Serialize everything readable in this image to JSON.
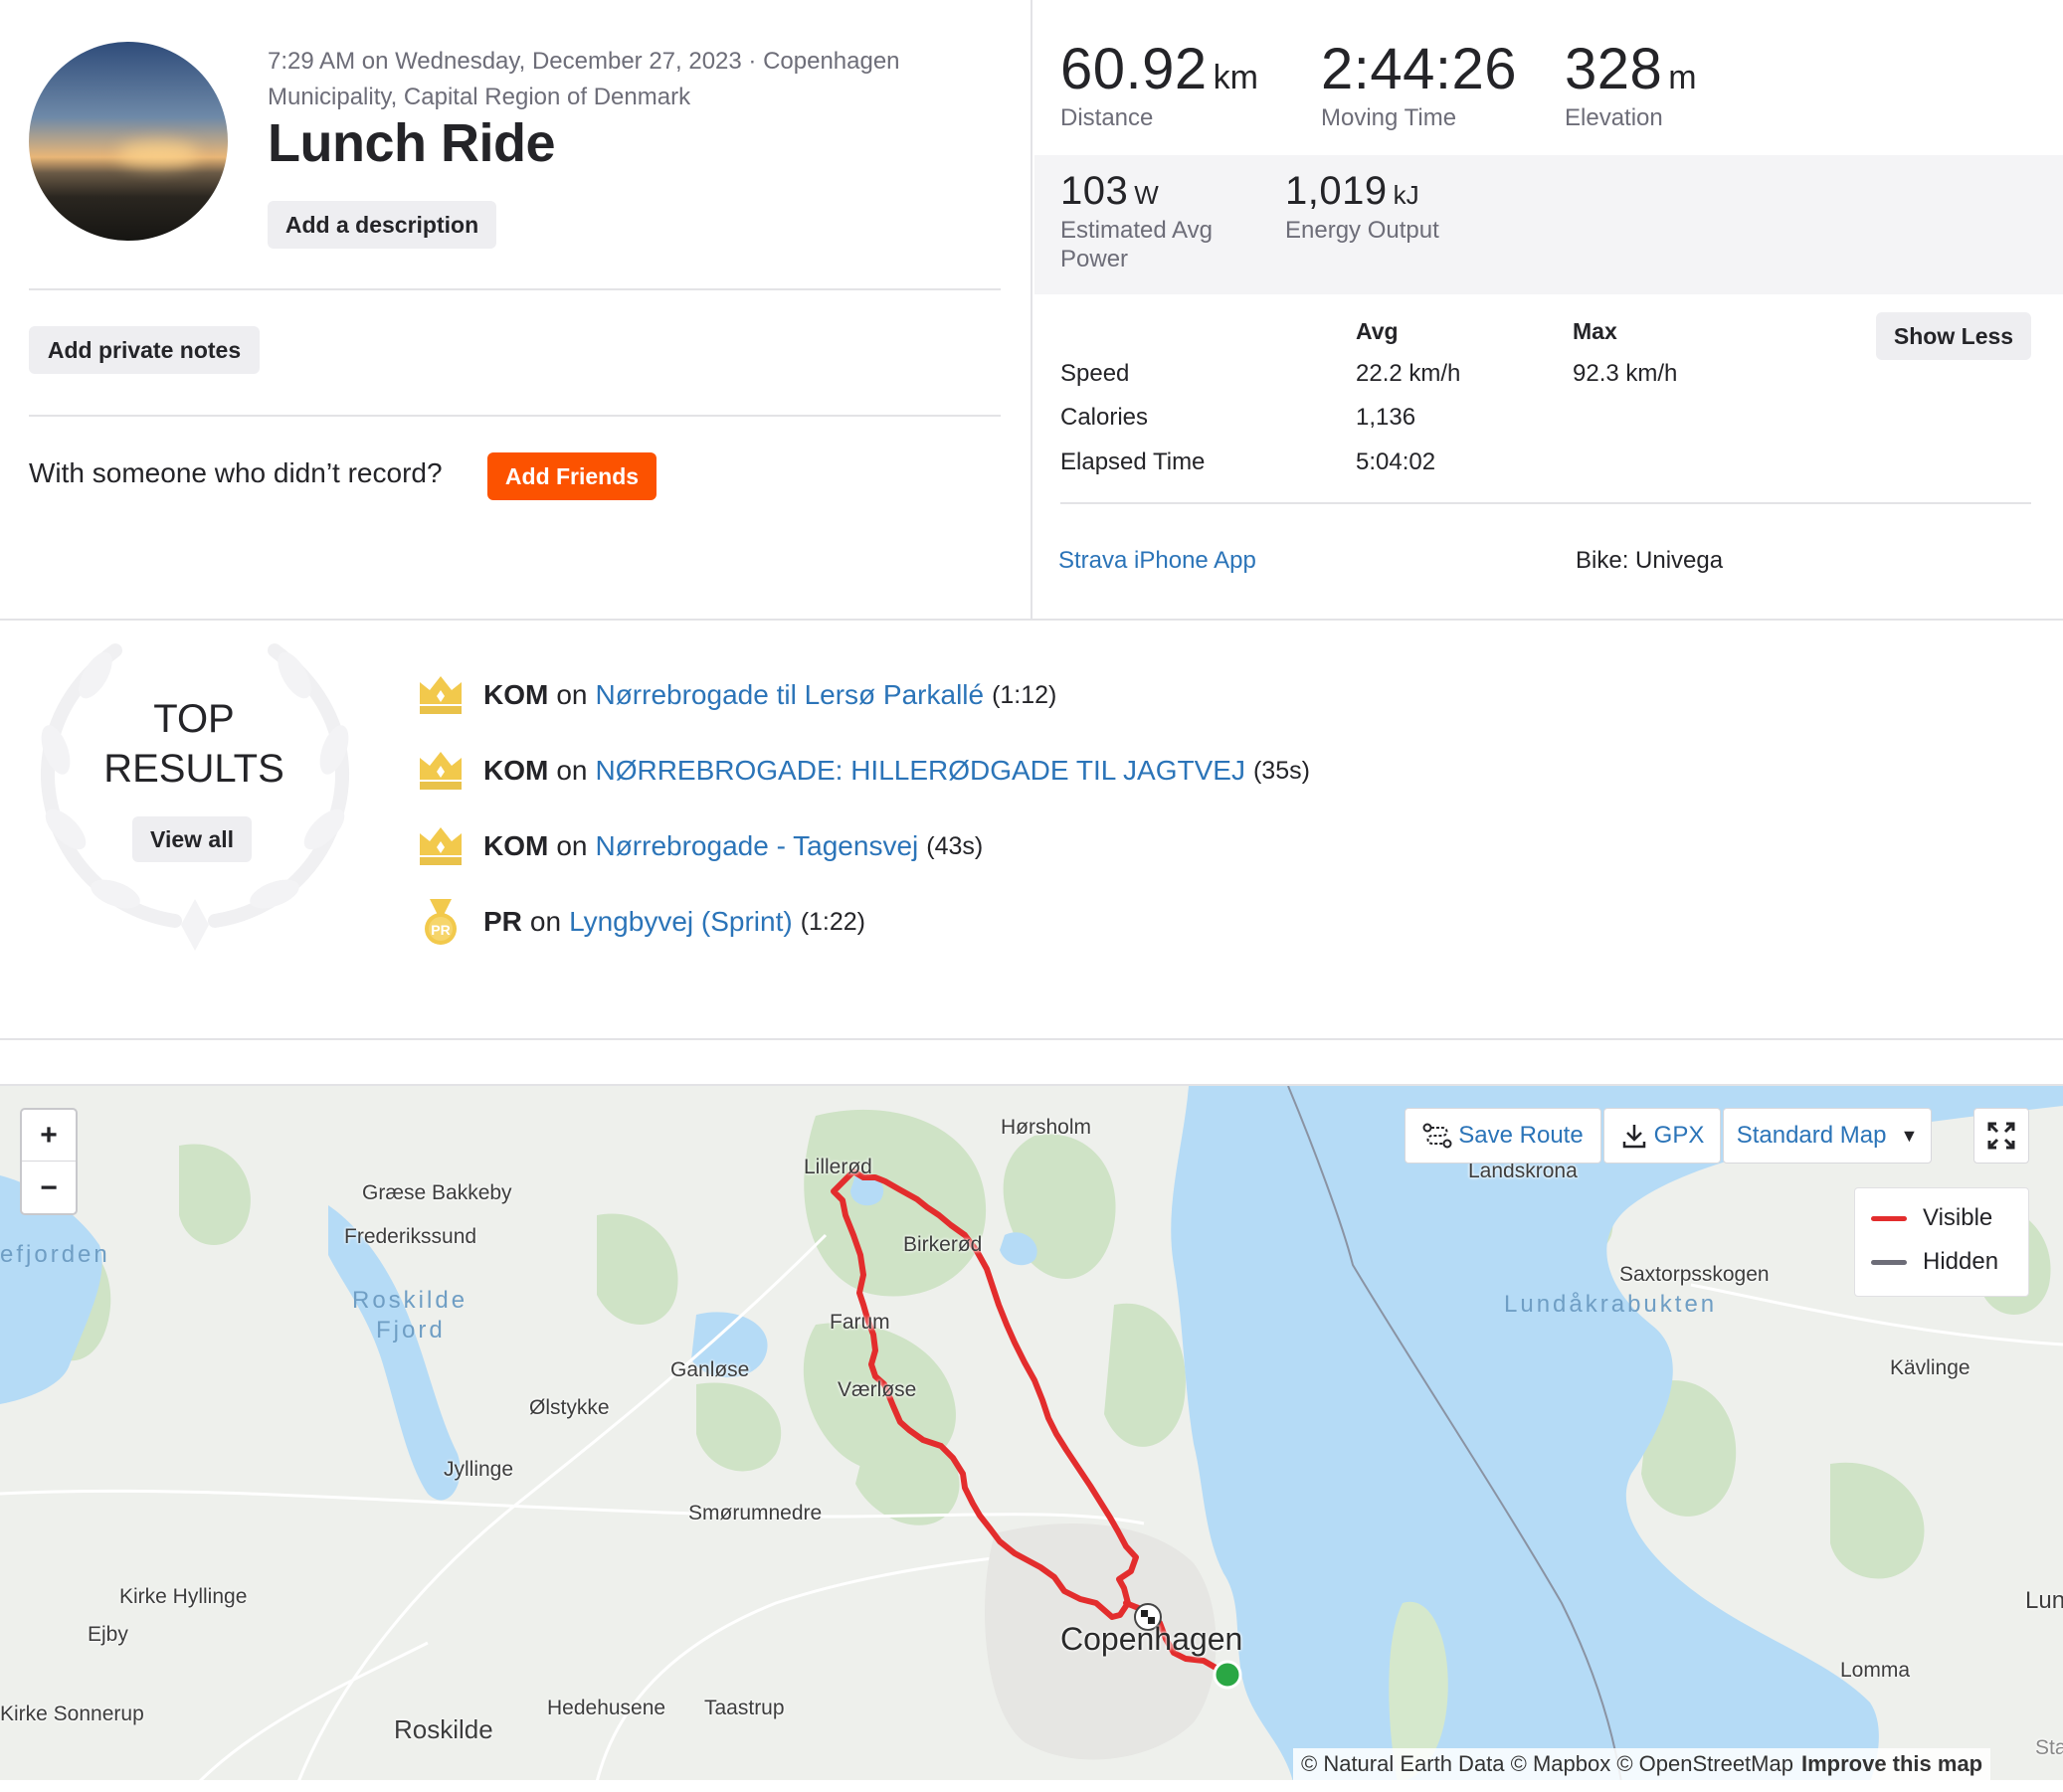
{
  "activity": {
    "datetime_location": "7:29 AM on Wednesday, December 27, 2023 · Copenhagen Municipality, Capital Region of Denmark",
    "title": "Lunch Ride",
    "add_description_label": "Add a description",
    "add_private_notes_label": "Add private notes",
    "friends_prompt": "With someone who didn’t record?",
    "add_friends_label": "Add Friends"
  },
  "stats": {
    "primary": [
      {
        "value": "60.92",
        "unit": "km",
        "label": "Distance"
      },
      {
        "value": "2:44:26",
        "unit": "",
        "label": "Moving Time"
      },
      {
        "value": "328",
        "unit": "m",
        "label": "Elevation"
      }
    ],
    "secondary": [
      {
        "value": "103",
        "unit": "W",
        "label": "Estimated Avg Power"
      },
      {
        "value": "1,019",
        "unit": "kJ",
        "label": "Energy Output"
      }
    ],
    "table": {
      "col_avg": "Avg",
      "col_max": "Max",
      "rows": [
        {
          "label": "Speed",
          "avg": "22.2 km/h",
          "max": "92.3 km/h"
        },
        {
          "label": "Calories",
          "avg": "1,136",
          "max": ""
        },
        {
          "label": "Elapsed Time",
          "avg": "5:04:02",
          "max": ""
        }
      ]
    },
    "show_less_label": "Show Less",
    "device": "Strava iPhone App",
    "bike": "Bike: Univega"
  },
  "top_results": {
    "title_line1": "TOP",
    "title_line2": "RESULTS",
    "view_all_label": "View all",
    "on_label": "on",
    "items": [
      {
        "type": "KOM",
        "icon": "crown-icon",
        "segment": "Nørrebrogade til Lersø Parkallé",
        "time": "(1:12)"
      },
      {
        "type": "KOM",
        "icon": "crown-icon",
        "segment": "NØRREBROGADE: HILLERØDGADE TIL JAGTVEJ",
        "time": "(35s)"
      },
      {
        "type": "KOM",
        "icon": "crown-icon",
        "segment": "Nørrebrogade - Tagensvej",
        "time": "(43s)"
      },
      {
        "type": "PR",
        "icon": "pr-medal-icon",
        "segment": "Lyngbyvej (Sprint)",
        "time": "(1:22)"
      }
    ]
  },
  "map": {
    "zoom_in": "+",
    "zoom_out": "−",
    "save_route_label": "Save Route",
    "gpx_label": "GPX",
    "map_style_label": "Standard Map",
    "legend": {
      "visible": "Visible",
      "hidden": "Hidden",
      "visible_color": "#e32d2d",
      "hidden_color": "#6d6d78"
    },
    "attribution": "© Natural Earth Data © Mapbox © OpenStreetMap",
    "improve_label": "Improve this map",
    "partial_labels": {
      "staf": "Staf",
      "landskrona": "Landskrona"
    },
    "places": [
      {
        "key": "horsholm",
        "name": "Hørsholm"
      },
      {
        "key": "lillerod",
        "name": "Lillerød"
      },
      {
        "key": "graese",
        "name": "Græse Bakkeby"
      },
      {
        "key": "frederikssund",
        "name": "Frederikssund"
      },
      {
        "key": "birkerod",
        "name": "Birkerød"
      },
      {
        "key": "farum",
        "name": "Farum"
      },
      {
        "key": "ganlose",
        "name": "Ganløse"
      },
      {
        "key": "vaerlose",
        "name": "Værløse"
      },
      {
        "key": "olstykke",
        "name": "Ølstykke"
      },
      {
        "key": "jyllinge",
        "name": "Jyllinge"
      },
      {
        "key": "smorumnedre",
        "name": "Smørumnedre"
      },
      {
        "key": "kirkehyllinge",
        "name": "Kirke Hyllinge"
      },
      {
        "key": "ejby",
        "name": "Ejby"
      },
      {
        "key": "kirkesonnerup",
        "name": "Kirke Sonnerup"
      },
      {
        "key": "hedehusene",
        "name": "Hedehusene"
      },
      {
        "key": "taastrup",
        "name": "Taastrup"
      },
      {
        "key": "roskilde",
        "name": "Roskilde"
      },
      {
        "key": "copenhagen",
        "name": "Copenhagen"
      },
      {
        "key": "saxtorp",
        "name": "Saxtorpsskogen"
      },
      {
        "key": "kavlinge",
        "name": "Kävlinge"
      },
      {
        "key": "lomma",
        "name": "Lomma"
      },
      {
        "key": "lund",
        "name": "Lun"
      }
    ],
    "water_labels": {
      "isefjorden": "efjorden",
      "roskilde_fjord_1": "Roskilde",
      "roskilde_fjord_2": "Fjord",
      "lundakrabukten": "Lundåkrabukten"
    },
    "route_color": "#e32d2d",
    "start_color": "#2aa744"
  }
}
